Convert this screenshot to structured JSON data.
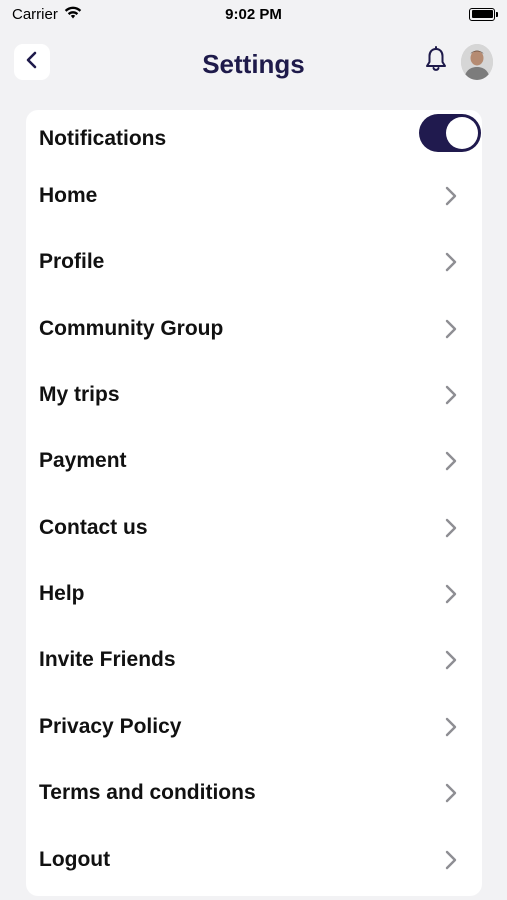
{
  "status_bar": {
    "carrier": "Carrier",
    "time": "9:02 PM"
  },
  "header": {
    "title": "Settings",
    "back_icon": "chevron-left-icon",
    "bell_icon": "bell-icon"
  },
  "notifications": {
    "label": "Notifications",
    "enabled": true
  },
  "menu": {
    "items": [
      {
        "label": "Home"
      },
      {
        "label": "Profile"
      },
      {
        "label": "Community Group"
      },
      {
        "label": "My trips"
      },
      {
        "label": "Payment"
      },
      {
        "label": "Contact us"
      },
      {
        "label": "Help"
      },
      {
        "label": "Invite Friends"
      },
      {
        "label": "Privacy Policy"
      },
      {
        "label": "Terms and conditions"
      },
      {
        "label": "Logout"
      }
    ]
  },
  "colors": {
    "accent": "#201a4e",
    "title": "#1e1a4a",
    "background": "#f2f2f4",
    "chevron": "#8e8e93"
  }
}
